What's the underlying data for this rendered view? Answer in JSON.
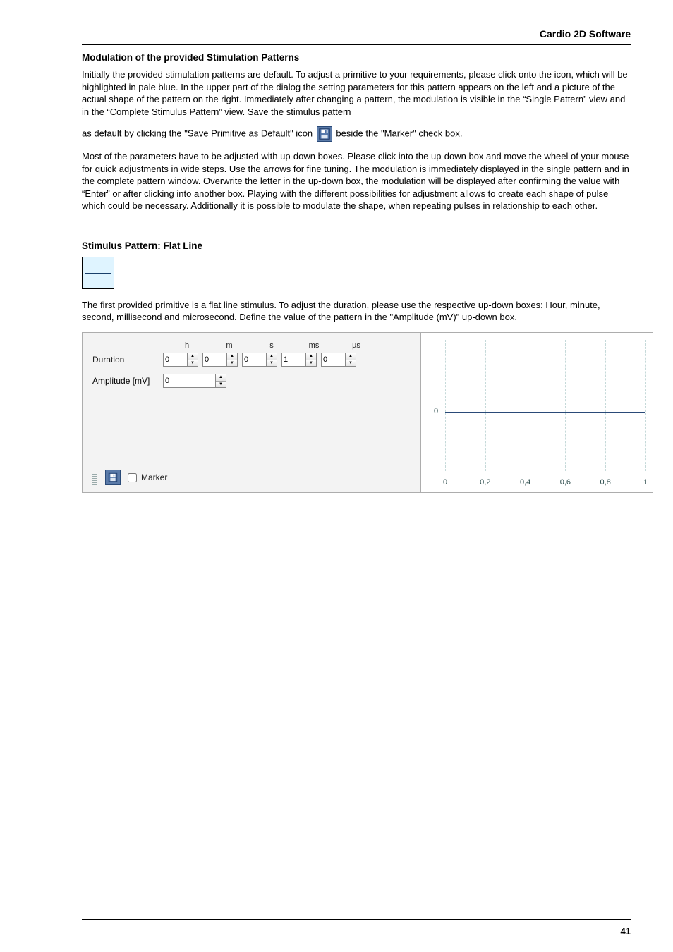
{
  "page": {
    "header_title": "Cardio 2D Software",
    "page_number": "41"
  },
  "headings": {
    "modulation": "Modulation of the provided Stimulation Patterns",
    "flatline": "Stimulus Pattern: Flat Line"
  },
  "paragraphs": {
    "p1": "Initially the provided stimulation patterns are default. To adjust a primitive to your requirements, please click onto the icon, which will be highlighted in pale blue. In the upper part of the dialog the setting parameters for this pattern appears on the left and a picture of the actual shape of the pattern on the right. Immediately after changing a pattern, the modulation is visible in the “Single Pattern” view and in the “Complete Stimulus Pattern” view. Save the stimulus pattern",
    "p1b_before": "as default by clicking the \"Save Primitive as Default\" icon",
    "p1b_after": " beside the \"Marker\" check box.",
    "p2": "Most of the parameters have to be adjusted with up-down boxes. Please click into the up-down box and move the wheel of your mouse for quick adjustments in wide steps. Use the arrows for fine tuning. The modulation is immediately displayed in the single pattern and in the complete pattern window. Overwrite the letter in the up-down box, the modulation will be displayed after confirming the value with “Enter” or after clicking into another box. Playing with the different possibilities for adjustment allows to create each shape of pulse which could be necessary. Additionally it is possible to modulate the shape, when repeating pulses in relationship to each other.",
    "p3": "The first provided primitive is a flat line stimulus. To adjust the duration, please use the respective up-down boxes: Hour, minute, second, millisecond and microsecond. Define the value of the pattern in the \"Amplitude (mV)\" up-down box."
  },
  "panel": {
    "duration_label": "Duration",
    "amplitude_label": "Amplitude [mV]",
    "marker_label": "Marker",
    "headers": {
      "h": "h",
      "m": "m",
      "s": "s",
      "ms": "ms",
      "us": "µs"
    },
    "values": {
      "h": "0",
      "m": "0",
      "s": "0",
      "ms": "1",
      "us": "0",
      "amp": "0"
    },
    "marker_checked": false
  },
  "chart_data": {
    "type": "line",
    "title": "",
    "xlabel": "",
    "ylabel": "",
    "xlim": [
      0,
      1
    ],
    "ylim": [
      -0.5,
      0.5
    ],
    "x_ticks": [
      "0",
      "0,2",
      "0,4",
      "0,6",
      "0,8",
      "1"
    ],
    "y_ticks": [
      "0"
    ],
    "series": [
      {
        "name": "flat",
        "x": [
          0,
          1
        ],
        "y": [
          0,
          0
        ]
      }
    ]
  }
}
